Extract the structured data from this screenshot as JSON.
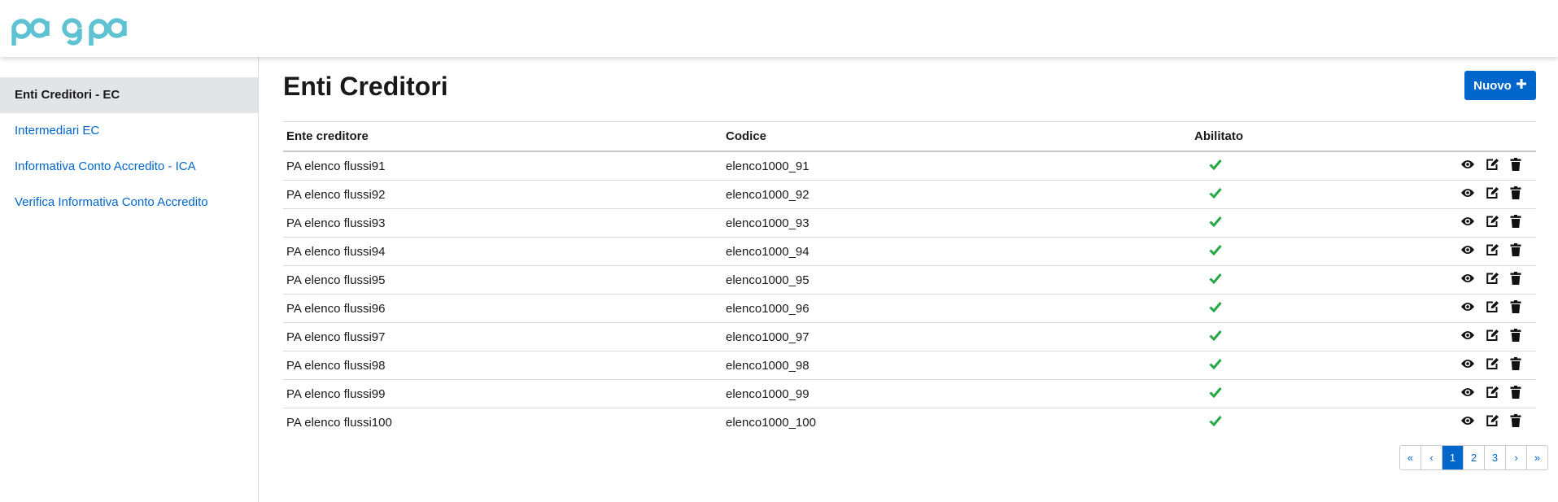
{
  "header": {
    "logo_text": "pagopa",
    "logo_color": "#5fc2d3"
  },
  "sidebar": {
    "items": [
      {
        "label": "Enti Creditori - EC",
        "active": true
      },
      {
        "label": "Intermediari EC",
        "active": false
      },
      {
        "label": "Informativa Conto Accredito - ICA",
        "active": false
      },
      {
        "label": "Verifica Informativa Conto Accredito",
        "active": false
      }
    ]
  },
  "main": {
    "title": "Enti Creditori",
    "new_button": {
      "label": "Nuovo",
      "icon": "plus-icon"
    },
    "table": {
      "columns": [
        "Ente creditore",
        "Codice",
        "Abilitato",
        ""
      ],
      "rows": [
        {
          "name": "PA elenco flussi91",
          "code": "elenco1000_91",
          "enabled": true
        },
        {
          "name": "PA elenco flussi92",
          "code": "elenco1000_92",
          "enabled": true
        },
        {
          "name": "PA elenco flussi93",
          "code": "elenco1000_93",
          "enabled": true
        },
        {
          "name": "PA elenco flussi94",
          "code": "elenco1000_94",
          "enabled": true
        },
        {
          "name": "PA elenco flussi95",
          "code": "elenco1000_95",
          "enabled": true
        },
        {
          "name": "PA elenco flussi96",
          "code": "elenco1000_96",
          "enabled": true
        },
        {
          "name": "PA elenco flussi97",
          "code": "elenco1000_97",
          "enabled": true
        },
        {
          "name": "PA elenco flussi98",
          "code": "elenco1000_98",
          "enabled": true
        },
        {
          "name": "PA elenco flussi99",
          "code": "elenco1000_99",
          "enabled": true
        },
        {
          "name": "PA elenco flussi100",
          "code": "elenco1000_100",
          "enabled": true
        }
      ],
      "row_actions": [
        "eye-icon",
        "edit-icon",
        "trash-icon"
      ]
    },
    "pagination": {
      "items": [
        "«",
        "‹",
        "1",
        "2",
        "3",
        "›",
        "»"
      ],
      "active": "1"
    }
  },
  "colors": {
    "primary": "#0066cc",
    "success": "#28a745",
    "sidebar_active_bg": "#e3e4e6"
  }
}
